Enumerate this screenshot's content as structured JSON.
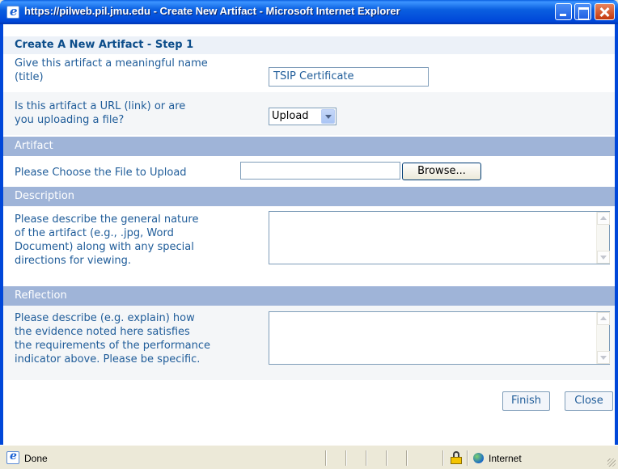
{
  "window": {
    "title": "https://pilweb.pil.jmu.edu - Create New Artifact - Microsoft Internet Explorer"
  },
  "form": {
    "heading": "Create A New Artifact - Step 1",
    "title_label_line1": "Give this artifact a meaningful name",
    "title_label_line2": "(title)",
    "title_value": "TSIP Certificate",
    "type_label_line1": "Is this artifact a URL (link) or are",
    "type_label_line2": "you uploading a file?",
    "type_selected": "Upload",
    "artifact_section": "Artifact",
    "file_label": "Please Choose the File to Upload",
    "browse_label": "Browse...",
    "description_section": "Description",
    "description_label_line1": "Please describe the general nature",
    "description_label_line2": "of the artifact (e.g., .jpg, Word",
    "description_label_line3": "Document) along with any special",
    "description_label_line4": "directions for viewing.",
    "reflection_section": "Reflection",
    "reflection_label_line1": "Please describe (e.g. explain) how",
    "reflection_label_line2": "the evidence noted here satisfies",
    "reflection_label_line3": "the requirements of the performance",
    "reflection_label_line4": "indicator above. Please be specific.",
    "finish_label": "Finish",
    "close_label": "Close"
  },
  "statusbar": {
    "status": "Done",
    "zone": "Internet"
  },
  "icons": {
    "ie": "internet-explorer-icon",
    "lock": "lock-icon",
    "globe": "globe-icon"
  }
}
